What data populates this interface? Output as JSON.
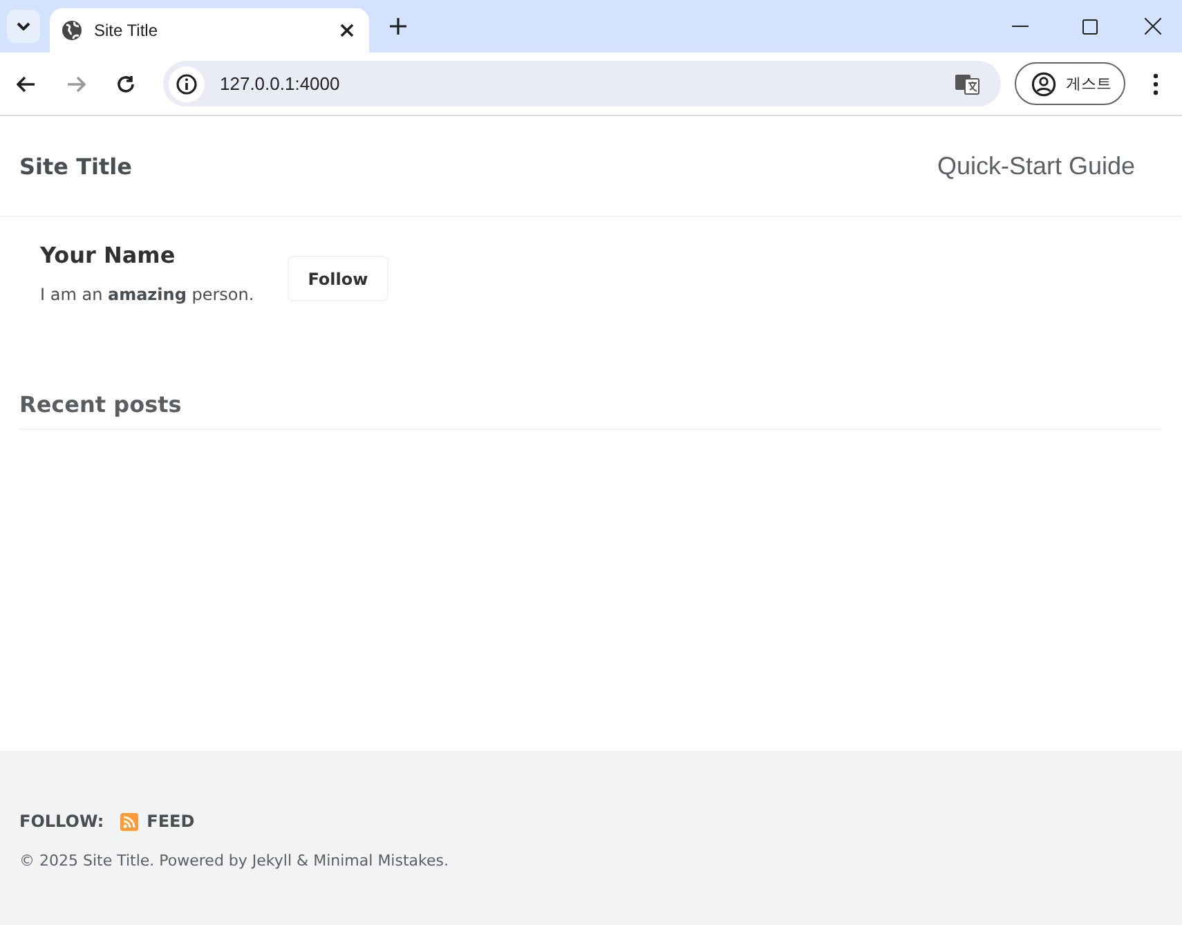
{
  "browser": {
    "tabs": [
      {
        "title": "Site Title",
        "selected": true
      }
    ],
    "address": "127.0.0.1:4000",
    "profile": "게스트"
  },
  "masthead": {
    "title": "Site Title",
    "nav": [
      {
        "label": "Quick-Start Guide"
      }
    ]
  },
  "author": {
    "name": "Your Name",
    "bio": "I am an **amazing** person.",
    "button": "Follow"
  },
  "recent": {
    "heading": "Recent posts"
  },
  "footer": {
    "follow_label": "FOLLOW:",
    "links": [
      {
        "label": "FEED"
      }
    ],
    "copyright": "© 2025 Site Title. Powered by Jekyll & Minimal Mistakes."
  }
}
